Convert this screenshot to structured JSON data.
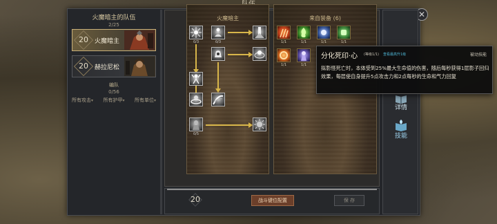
{
  "header": {
    "title": "队伍"
  },
  "party": {
    "title": "火魔暗主的队伍",
    "count": "2/25",
    "members": [
      {
        "level": "20",
        "name": "火魔暗主",
        "selected": true
      },
      {
        "level": "20",
        "name": "赫拉尼松",
        "selected": false
      }
    ],
    "formation_title": "编队",
    "formation_count": "0/56",
    "filters": [
      "所有攻击",
      "所有护甲",
      "所有单位"
    ]
  },
  "skill_tree": {
    "title": "火魔暗主",
    "nodes": [
      {
        "icon": "burst-skill-icon",
        "count": "0/3"
      },
      {
        "icon": "meditate-skill-icon",
        "count": "0/3"
      },
      {
        "icon": "light-pillar-skill-icon",
        "count": ""
      },
      {
        "icon": "hand-grab-skill-icon",
        "count": ""
      },
      {
        "icon": "aura-figure-skill-icon",
        "count": ""
      },
      {
        "icon": "whirl-skill-icon",
        "count": ""
      },
      {
        "icon": "slash-skill-icon",
        "count": ""
      },
      {
        "icon": "shadow-figure-skill-icon",
        "count": "0/5"
      },
      {
        "icon": "shadow-burst-skill-icon",
        "count": ""
      }
    ]
  },
  "equipment": {
    "title": "来自装备 (6)",
    "items": [
      {
        "icon": "fire-claw-icon",
        "count": "1/1",
        "color": "#c4421c"
      },
      {
        "icon": "green-flame-icon",
        "count": "1/1",
        "color": "#3c8c2a"
      },
      {
        "icon": "blue-orb-icon",
        "count": "1/1",
        "color": "#3a5a9e"
      },
      {
        "icon": "green-fist-icon",
        "count": "1/1",
        "color": "#3f8a3e"
      },
      {
        "icon": "fire-ring-icon",
        "count": "1/1",
        "color": "#d0661e"
      },
      {
        "icon": "shadow-spirit-icon",
        "count": "1/1",
        "color": "#5a4ca0"
      }
    ]
  },
  "footer": {
    "page": "20",
    "config_button": "战斗键位配置",
    "save_button": "保 存"
  },
  "side_tabs": [
    {
      "label": "详情",
      "icon": "book-icon"
    },
    {
      "label": "技能",
      "icon": "skill-book-icon"
    }
  ],
  "tooltip": {
    "name": "分化死印·心",
    "level": "(等级1/1)",
    "upgrade": "查看最高升1级",
    "type": "被动技能",
    "description": "拟影怪死亡时，本体受到25%最大生命值的伤害，随后每秒获得1层影子回归效果，每层使自身提升5点攻击力和2点每秒的生命和气力回复"
  },
  "colors": {
    "accent_gold": "#d8b64a",
    "config_button": "#6b3f2a",
    "upgrade_link": "#4fb7d6"
  }
}
